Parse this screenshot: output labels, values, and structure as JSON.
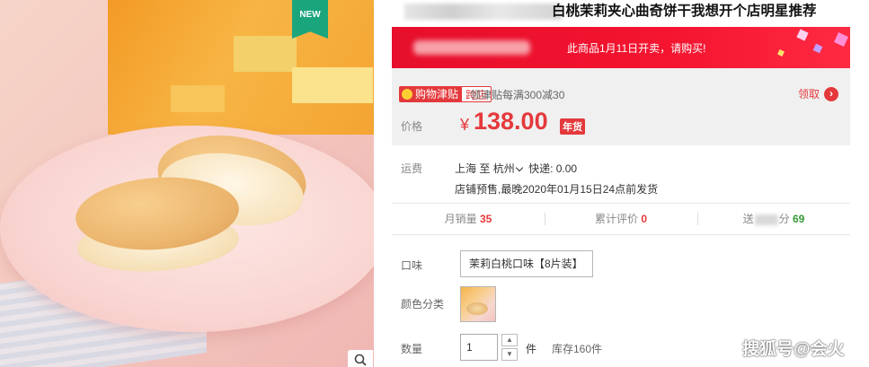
{
  "gallery": {
    "badge": "NEW",
    "zoom_icon": "magnifier-icon"
  },
  "product": {
    "title": "白桃茉莉夹心曲奇饼干我想开个店明星推荐"
  },
  "promo": {
    "notice": "此商品1月11日开卖，请购买!"
  },
  "subsidy": {
    "tag_main": "购物津贴",
    "tag_cross": "跨店",
    "description": "领津贴每满300减30",
    "claim_label": "领取",
    "claim_arrow": "›"
  },
  "price": {
    "label": "价格",
    "currency": "¥",
    "value": "138.00",
    "badge": "年货"
  },
  "shipping": {
    "label": "运费",
    "from": "上海",
    "to_word": "至",
    "dest": "杭州",
    "fee": "快递: 0.00",
    "note": "店铺预售,最晚2020年01月15日24点前发货"
  },
  "stats": {
    "monthly_sales_label": "月销量",
    "monthly_sales": "35",
    "reviews_label": "累计评价",
    "reviews": "0",
    "points_prefix": "送",
    "points_suffix": "分",
    "points": "69"
  },
  "options": {
    "flavor_label": "口味",
    "flavor_value": "茉莉白桃口味【8片装】",
    "color_label": "颜色分类",
    "qty_label": "数量",
    "qty_value": "1",
    "qty_up": "▲",
    "qty_down": "▼",
    "qty_unit": "件",
    "stock": "库存160件"
  },
  "watermark": "搜狐号@会火",
  "colors": {
    "accent_red": "#e4393c",
    "badge_green": "#1aa57d",
    "points_green": "#339933"
  }
}
